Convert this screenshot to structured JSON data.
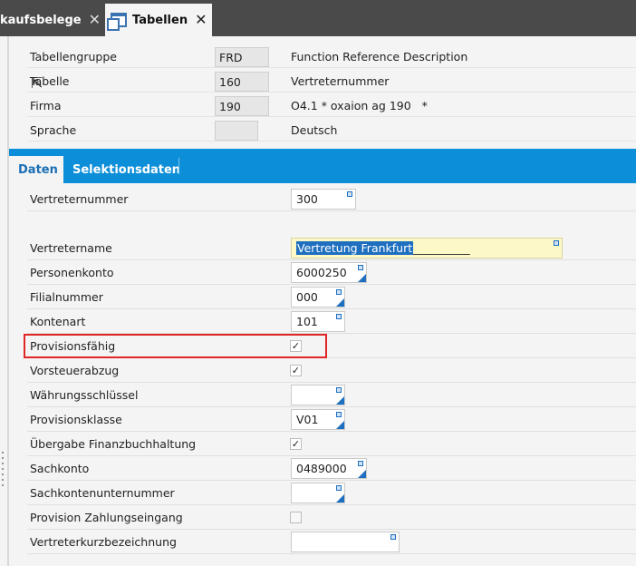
{
  "tabs": [
    {
      "label": "kaufsbelege",
      "active": false
    },
    {
      "label": "Tabellen",
      "active": true
    }
  ],
  "header": [
    {
      "label": "Tabellengruppe",
      "value": "FRD",
      "description": "Function Reference Description"
    },
    {
      "label": "Tabelle",
      "value": "160",
      "description": "Vertreternummer"
    },
    {
      "label": "Firma",
      "value": "190",
      "description": "O4.1 * oxaion ag 190   *"
    },
    {
      "label": "Sprache",
      "value": "",
      "description": "Deutsch"
    }
  ],
  "subtabs": [
    {
      "label": "Daten",
      "active": true
    },
    {
      "label": "Selektionsdaten",
      "active": false
    }
  ],
  "fields": {
    "vertreternummer": {
      "label": "Vertreternummer",
      "value": "300"
    },
    "vertretername": {
      "label": "Vertretername",
      "value": "Vertretung Frankfurt",
      "trailing": "__________"
    },
    "personenkonto": {
      "label": "Personenkonto",
      "value": "6000250"
    },
    "filialnummer": {
      "label": "Filialnummer",
      "value": "000"
    },
    "kontenart": {
      "label": "Kontenart",
      "value": "101"
    },
    "provisionsfaehig": {
      "label": "Provisionsfähig",
      "checked": true
    },
    "vorsteuerabzug": {
      "label": "Vorsteuerabzug",
      "checked": true
    },
    "waehrungsschluessel": {
      "label": "Währungsschlüssel",
      "value": ""
    },
    "provisionsklasse": {
      "label": "Provisionsklasse",
      "value": "V01"
    },
    "uebergabe": {
      "label": "Übergabe Finanzbuchhaltung",
      "checked": true
    },
    "sachkonto": {
      "label": "Sachkonto",
      "value": "0489000"
    },
    "sachkontenunternummer": {
      "label": "Sachkontenunternummer",
      "value": ""
    },
    "provision_zahlungseingang": {
      "label": "Provision Zahlungseingang",
      "checked": false
    },
    "vertreterkurzbezeichnung": {
      "label": "Vertreterkurzbezeichnung",
      "value": ""
    }
  },
  "check_glyph": "✓",
  "colors": {
    "accent": "#0c8fd8",
    "highlight": "#e02525",
    "selection": "#1e6fc0",
    "yellow_field": "#fdf8c8"
  }
}
